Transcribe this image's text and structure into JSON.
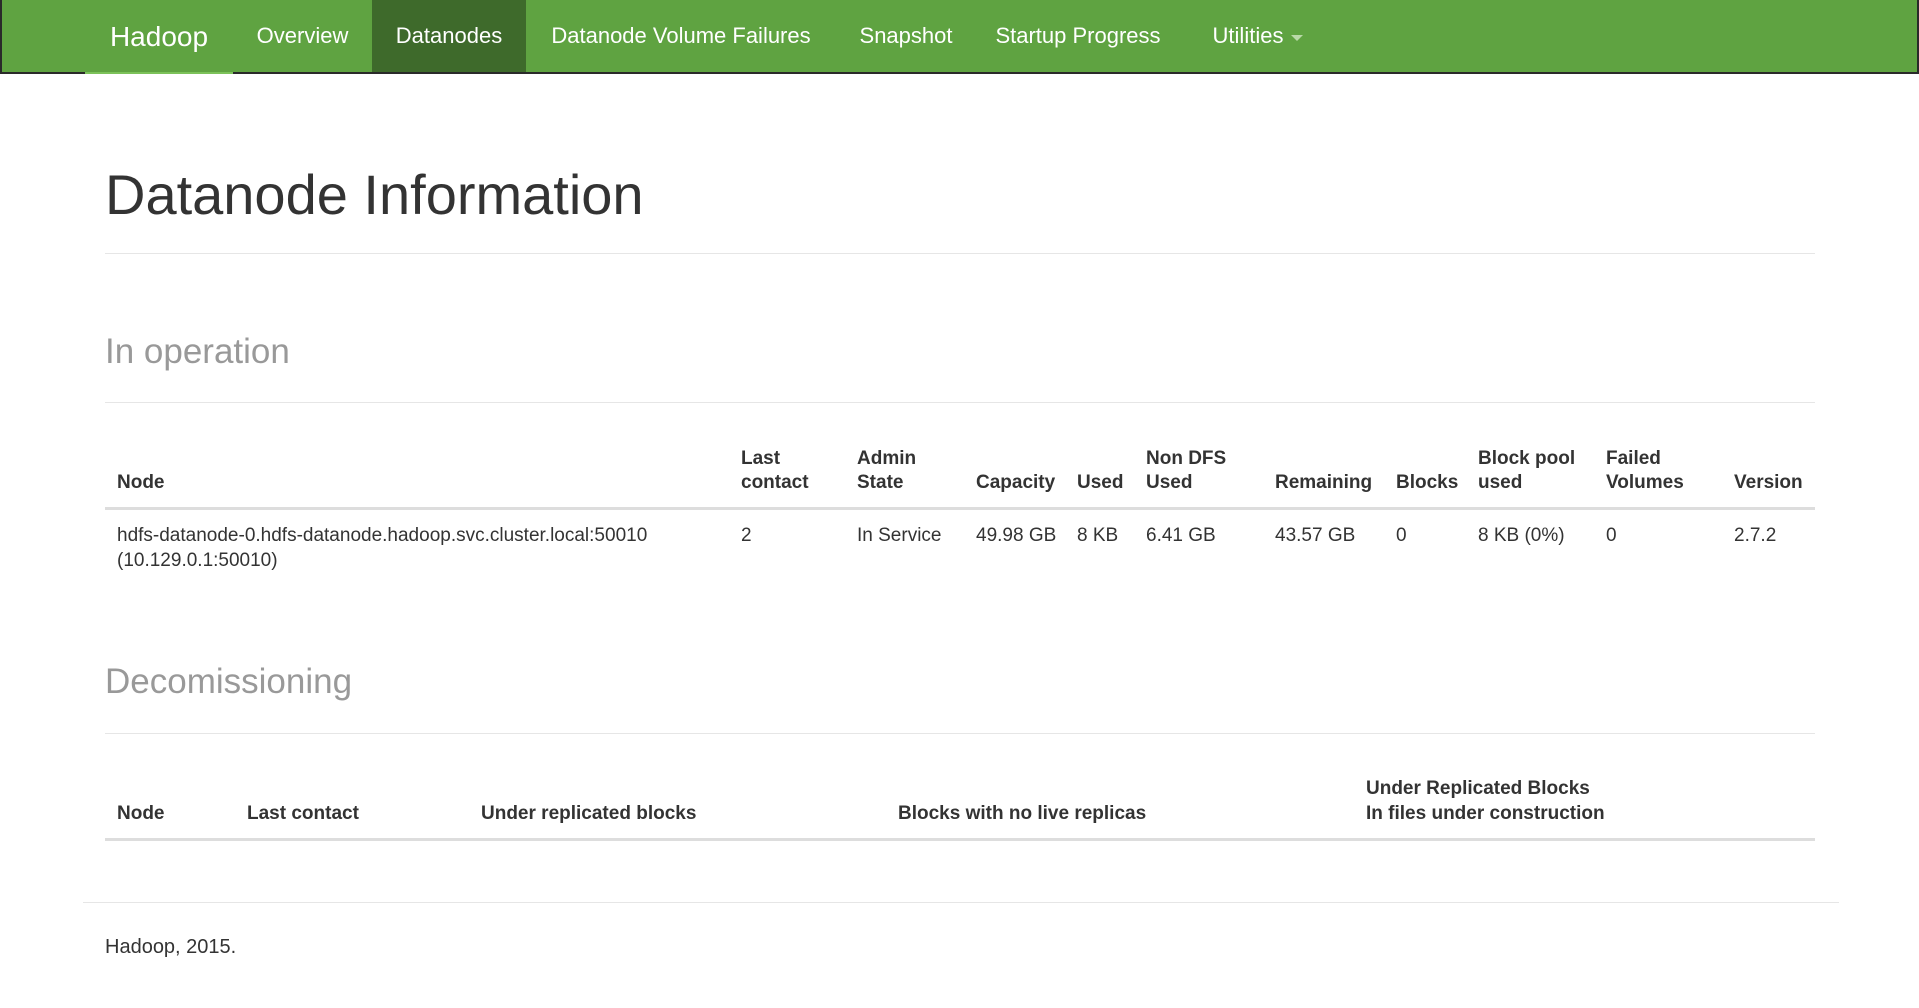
{
  "navbar": {
    "brand": "Hadoop",
    "items": [
      {
        "label": "Overview"
      },
      {
        "label": "Datanodes",
        "active": true
      },
      {
        "label": "Datanode Volume Failures"
      },
      {
        "label": "Snapshot"
      },
      {
        "label": "Startup Progress"
      },
      {
        "label": "Utilities",
        "dropdown": true
      }
    ],
    "colors": {
      "background": "#5fa341",
      "active": "#3e6a2b"
    }
  },
  "page_title": "Datanode Information",
  "in_operation": {
    "title": "In operation",
    "headers": {
      "node": "Node",
      "last_contact": [
        "Last",
        "contact"
      ],
      "admin_state": [
        "Admin",
        "State"
      ],
      "capacity": "Capacity",
      "used": "Used",
      "non_dfs_used": [
        "Non DFS",
        "Used"
      ],
      "remaining": "Remaining",
      "blocks": "Blocks",
      "block_pool_used": [
        "Block pool",
        "used"
      ],
      "failed_volumes": [
        "Failed",
        "Volumes"
      ],
      "version": "Version"
    },
    "rows": [
      {
        "node": [
          "hdfs-datanode-0.hdfs-datanode.hadoop.svc.cluster.local:50010",
          "(10.129.0.1:50010)"
        ],
        "last_contact": "2",
        "admin_state": "In Service",
        "capacity": "49.98 GB",
        "used": "8 KB",
        "non_dfs_used": "6.41 GB",
        "remaining": "43.57 GB",
        "blocks": "0",
        "block_pool_used": "8 KB (0%)",
        "failed_volumes": "0",
        "version": "2.7.2"
      }
    ]
  },
  "decomissioning": {
    "title": "Decomissioning",
    "headers": {
      "node": "Node",
      "last_contact": "Last contact",
      "under_replicated": "Under replicated blocks",
      "no_live_replicas": "Blocks with no live replicas",
      "under_construction": [
        "Under Replicated Blocks",
        "In files under construction"
      ]
    }
  },
  "footer": "Hadoop, 2015."
}
